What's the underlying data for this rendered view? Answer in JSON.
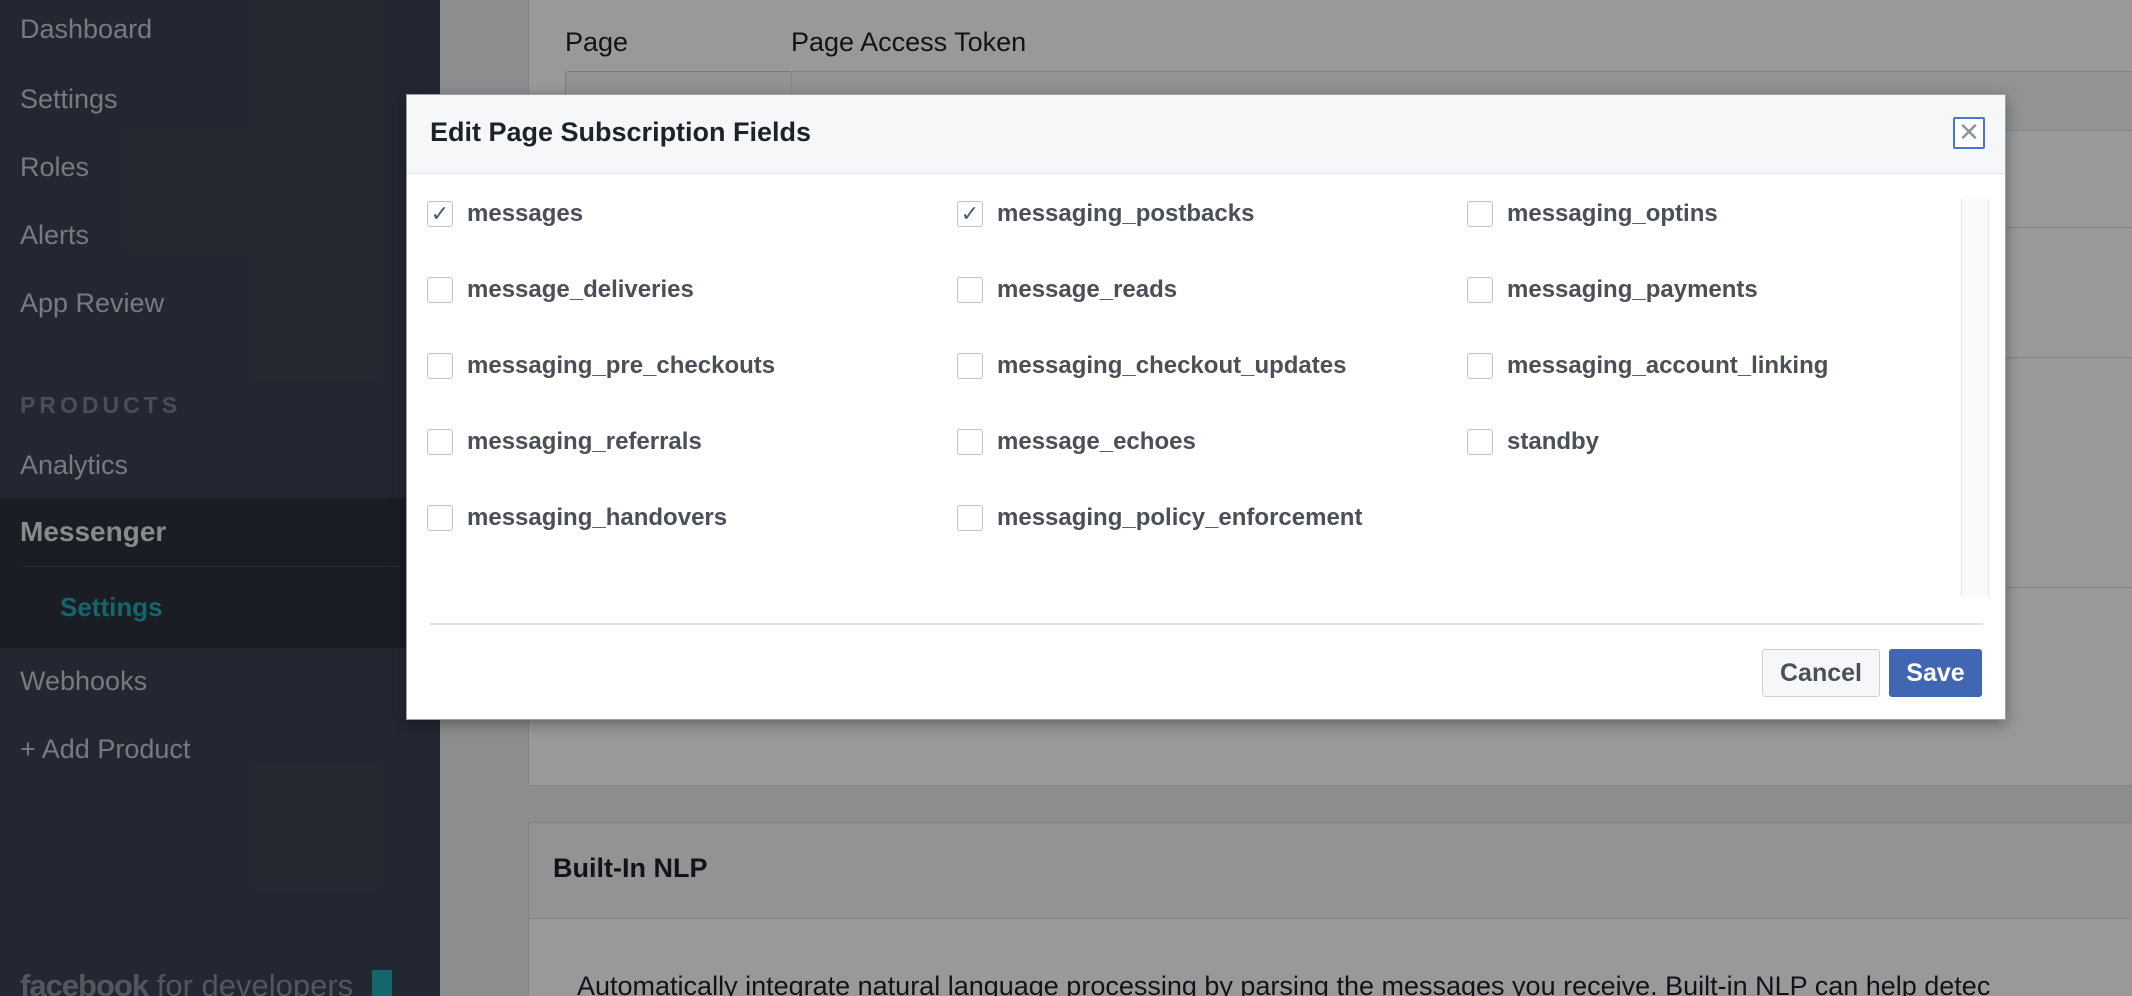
{
  "sidebar": {
    "items_top": [
      "Dashboard",
      "Settings",
      "Roles",
      "Alerts",
      "App Review"
    ],
    "products_heading": "PRODUCTS",
    "analytics": "Analytics",
    "messenger": "Messenger",
    "messenger_settings": "Settings",
    "webhooks": "Webhooks",
    "add_product": "+ Add Product",
    "brand_fb": "facebook",
    "brand_for": "for developers"
  },
  "background": {
    "page_label": "Page",
    "token_label": "Page Access Token",
    "nlp_title": "Built-In NLP",
    "nlp_desc": "Automatically integrate natural language processing by parsing the messages you receive. Built-in NLP can help detec"
  },
  "modal": {
    "title": "Edit Page Subscription Fields",
    "close_glyph": "✕",
    "fields": [
      {
        "name": "messages",
        "checked": true
      },
      {
        "name": "messaging_postbacks",
        "checked": true
      },
      {
        "name": "messaging_optins",
        "checked": false
      },
      {
        "name": "message_deliveries",
        "checked": false
      },
      {
        "name": "message_reads",
        "checked": false
      },
      {
        "name": "messaging_payments",
        "checked": false
      },
      {
        "name": "messaging_pre_checkouts",
        "checked": false
      },
      {
        "name": "messaging_checkout_updates",
        "checked": false
      },
      {
        "name": "messaging_account_linking",
        "checked": false
      },
      {
        "name": "messaging_referrals",
        "checked": false
      },
      {
        "name": "message_echoes",
        "checked": false
      },
      {
        "name": "standby",
        "checked": false
      },
      {
        "name": "messaging_handovers",
        "checked": false
      },
      {
        "name": "messaging_policy_enforcement",
        "checked": false
      }
    ],
    "cancel_label": "Cancel",
    "save_label": "Save"
  },
  "colors": {
    "accent": "#4267b2",
    "sidebar_bg": "#3b4252",
    "teal": "#20aab4"
  }
}
